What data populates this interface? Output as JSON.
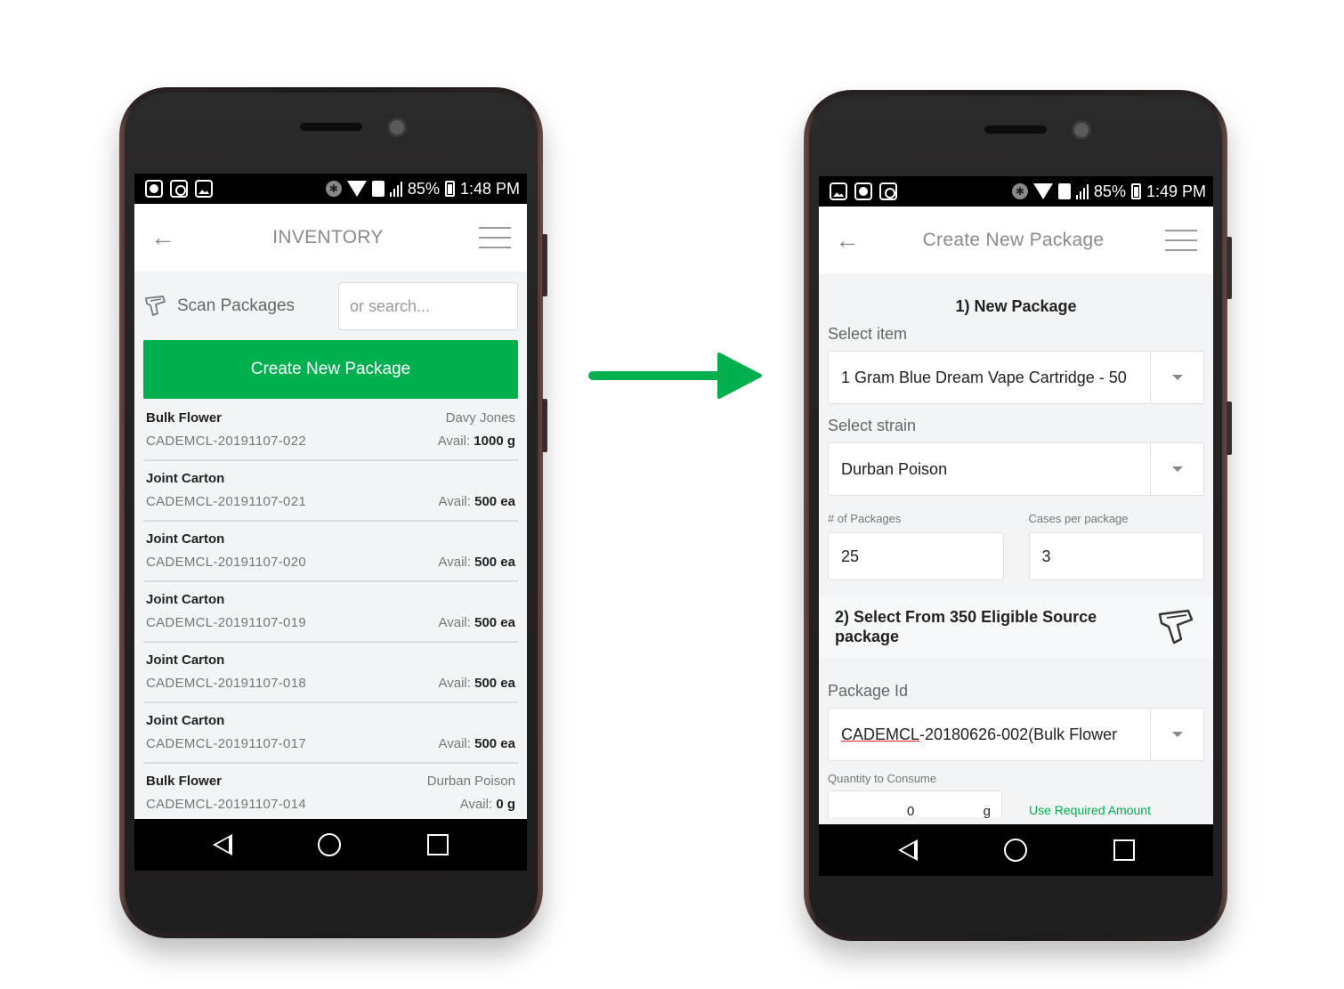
{
  "status_left": {
    "time": "1:48 PM",
    "battery": "85%"
  },
  "status_right": {
    "time": "1:49 PM",
    "battery": "85%"
  },
  "inventory": {
    "title": "INVENTORY",
    "scan_label": "Scan Packages",
    "search_placeholder": "or search...",
    "create_button": "Create New Package",
    "avail_prefix": "Avail:",
    "items": [
      {
        "name": "Bulk Flower",
        "owner": "Davy Jones",
        "id": "CADEMCL-20191107-022",
        "avail": "1000 g"
      },
      {
        "name": "Joint Carton",
        "owner": "",
        "id": "CADEMCL-20191107-021",
        "avail": "500 ea"
      },
      {
        "name": "Joint Carton",
        "owner": "",
        "id": "CADEMCL-20191107-020",
        "avail": "500 ea"
      },
      {
        "name": "Joint Carton",
        "owner": "",
        "id": "CADEMCL-20191107-019",
        "avail": "500 ea"
      },
      {
        "name": "Joint Carton",
        "owner": "",
        "id": "CADEMCL-20191107-018",
        "avail": "500 ea"
      },
      {
        "name": "Joint Carton",
        "owner": "",
        "id": "CADEMCL-20191107-017",
        "avail": "500 ea"
      },
      {
        "name": "Bulk Flower",
        "owner": "Durban Poison",
        "id": "CADEMCL-20191107-014",
        "avail": "0 g"
      }
    ]
  },
  "create": {
    "title": "Create New Package",
    "section1": "1) New Package",
    "select_item_label": "Select item",
    "select_item_value": "1 Gram Blue Dream Vape Cartridge - 50",
    "select_strain_label": "Select strain",
    "select_strain_value": "Durban Poison",
    "num_packages_label": "# of Packages",
    "num_packages_value": "25",
    "cases_label": "Cases per package",
    "cases_value": "3",
    "section2": "2) Select From 350 Eligible Source package",
    "package_id_label": "Package Id",
    "package_id_prefix": "CADEMCL",
    "package_id_rest": "-20180626-002(Bulk Flower",
    "qty_label": "Quantity to Consume",
    "qty_value": "0",
    "qty_unit": "g",
    "use_required": "Use Required Amount"
  },
  "colors": {
    "accent": "#00b04f",
    "arrow": "#00b04f"
  }
}
